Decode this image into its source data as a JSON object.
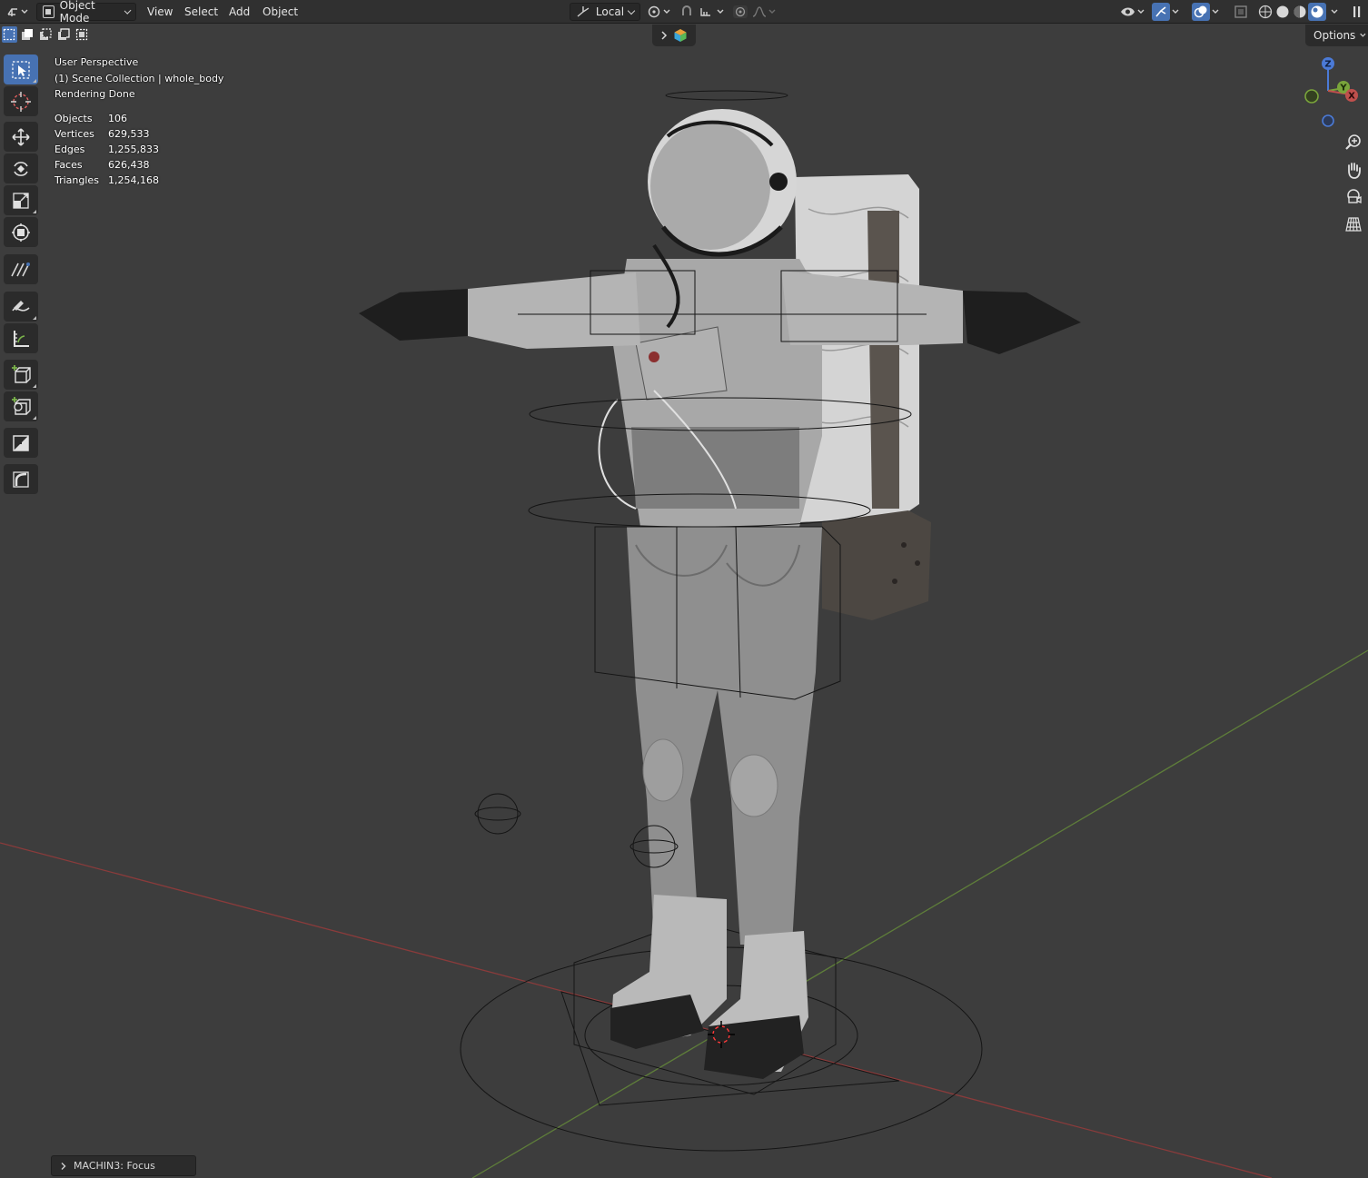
{
  "header": {
    "editor_type_icon": "3d-viewport-icon",
    "mode": "Object Mode",
    "menus": [
      "View",
      "Select",
      "Add",
      "Object"
    ],
    "transform_orientation": "Local"
  },
  "viewport": {
    "perspective": "User Perspective",
    "collection": "(1) Scene Collection | whole_body",
    "status": "Rendering Done",
    "stats": [
      {
        "label": "Objects",
        "value": "106"
      },
      {
        "label": "Vertices",
        "value": "629,533"
      },
      {
        "label": "Edges",
        "value": "1,255,833"
      },
      {
        "label": "Faces",
        "value": "626,438"
      },
      {
        "label": "Triangles",
        "value": "1,254,168"
      }
    ],
    "options_label": "Options",
    "gizmo_axes": {
      "z": "Z",
      "y": "Y",
      "x": "X"
    }
  },
  "toolbar": {
    "tools": [
      "select-box",
      "cursor",
      "move",
      "rotate",
      "scale",
      "transform",
      "annotate",
      "annotate-line",
      "measure",
      "add-cube",
      "add-object",
      "shrink",
      "edge-slide"
    ]
  },
  "last_operator": {
    "label": "MACHIN3: Focus"
  },
  "colors": {
    "accent": "#4772b3",
    "x_axis": "#c0504d",
    "y_axis": "#7aa53b",
    "z_axis": "#4b7ad6"
  }
}
